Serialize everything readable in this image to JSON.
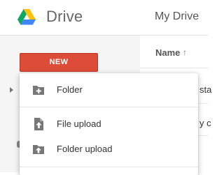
{
  "header": {
    "app_name": "Drive",
    "breadcrumb": "My Drive"
  },
  "list": {
    "column_name": "Name",
    "sort_arrow": "↑",
    "peek_rows": [
      "sta",
      "y c"
    ]
  },
  "sidebar": {
    "new_button": "NEW"
  },
  "new_menu": {
    "items": [
      {
        "label": "Folder",
        "icon": "new-folder-icon"
      },
      {
        "label": "File upload",
        "icon": "file-upload-icon"
      },
      {
        "label": "Folder upload",
        "icon": "folder-upload-icon"
      }
    ]
  },
  "colors": {
    "new_button": "#dd4b39",
    "drive_green": "#0da960",
    "drive_yellow": "#ffc107",
    "drive_blue": "#4285f4"
  }
}
